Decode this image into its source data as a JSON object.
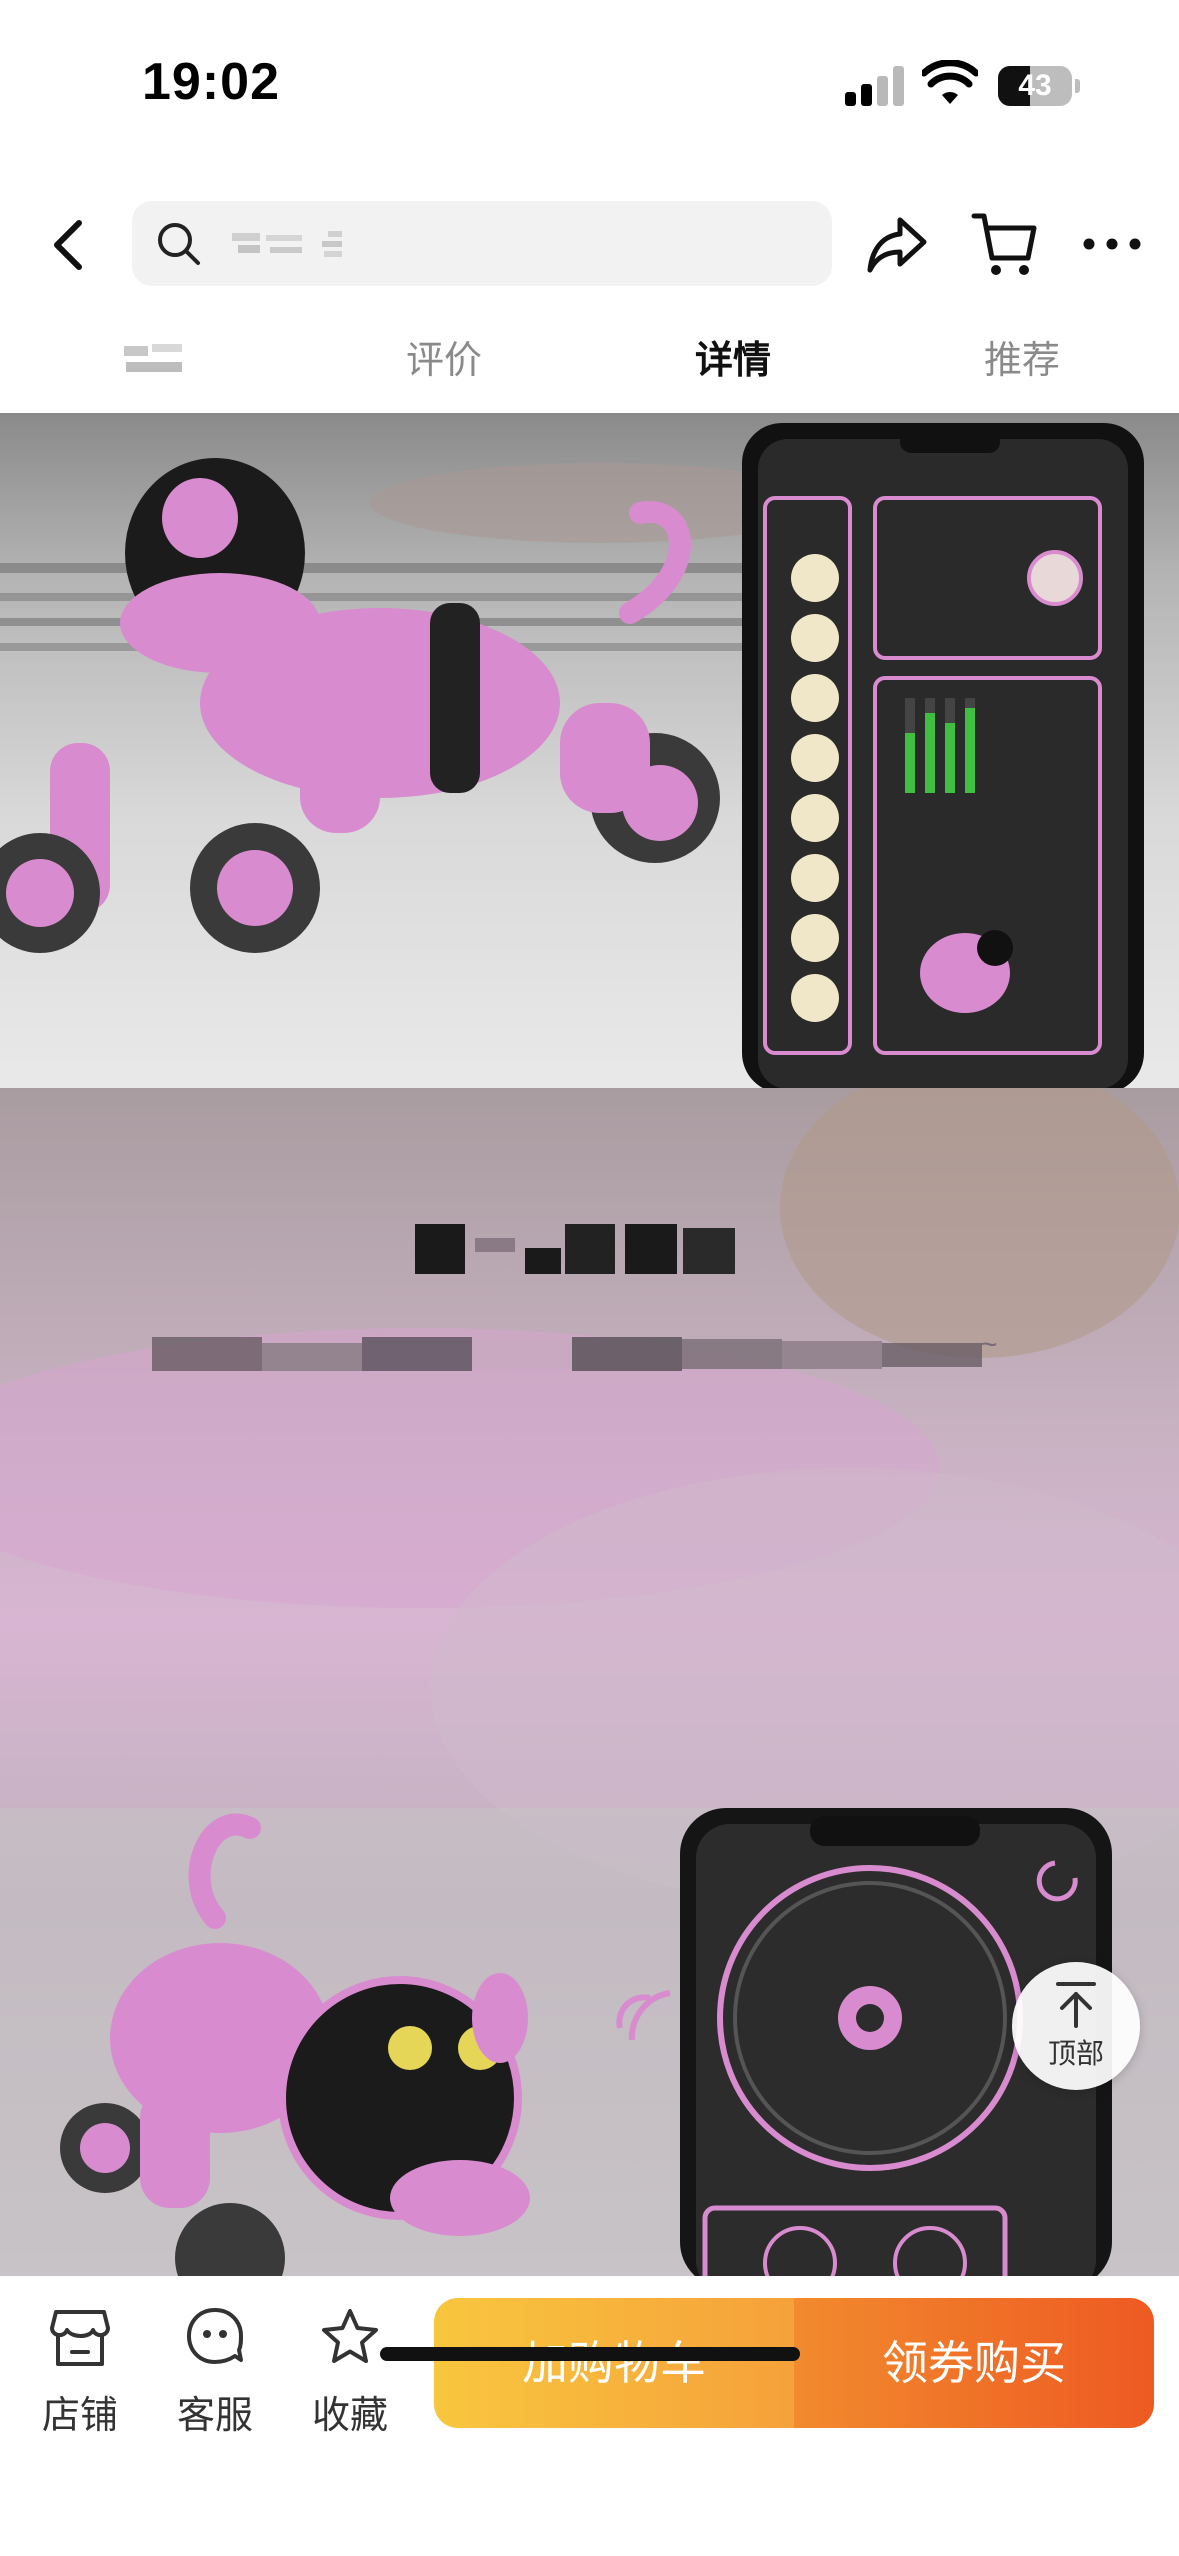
{
  "status_bar": {
    "time": "19:02",
    "battery_level": "43",
    "battery_fraction": 0.43,
    "signal_bars_active": 2,
    "signal_bars_total": 4
  },
  "header": {
    "back_icon": "chevron-left-icon",
    "search_placeholder": "",
    "share_icon": "share-icon",
    "cart_icon": "cart-icon",
    "more_icon": "more-dots-icon"
  },
  "tabs": [
    {
      "label": "",
      "active": false
    },
    {
      "label": "评价",
      "active": false
    },
    {
      "label": "详情",
      "active": true
    },
    {
      "label": "推荐",
      "active": false
    }
  ],
  "detail": {
    "image1_desc_icon": "robot-dog-app-image",
    "image2_tilde": "~",
    "image2_icon": "robot-dog-controller-image"
  },
  "top_button": {
    "label": "顶部",
    "icon": "arrow-up-to-top-icon"
  },
  "bottom_bar": {
    "actions": [
      {
        "label": "店铺",
        "icon": "store-icon"
      },
      {
        "label": "客服",
        "icon": "customer-service-icon"
      },
      {
        "label": "收藏",
        "icon": "star-icon"
      }
    ],
    "add_to_cart_label": "加购物车",
    "buy_label": "领券购买"
  },
  "colors": {
    "cart_button_start": "#f8c63e",
    "buy_button_end": "#ee5a22",
    "product_pink": "#d98bd0"
  }
}
